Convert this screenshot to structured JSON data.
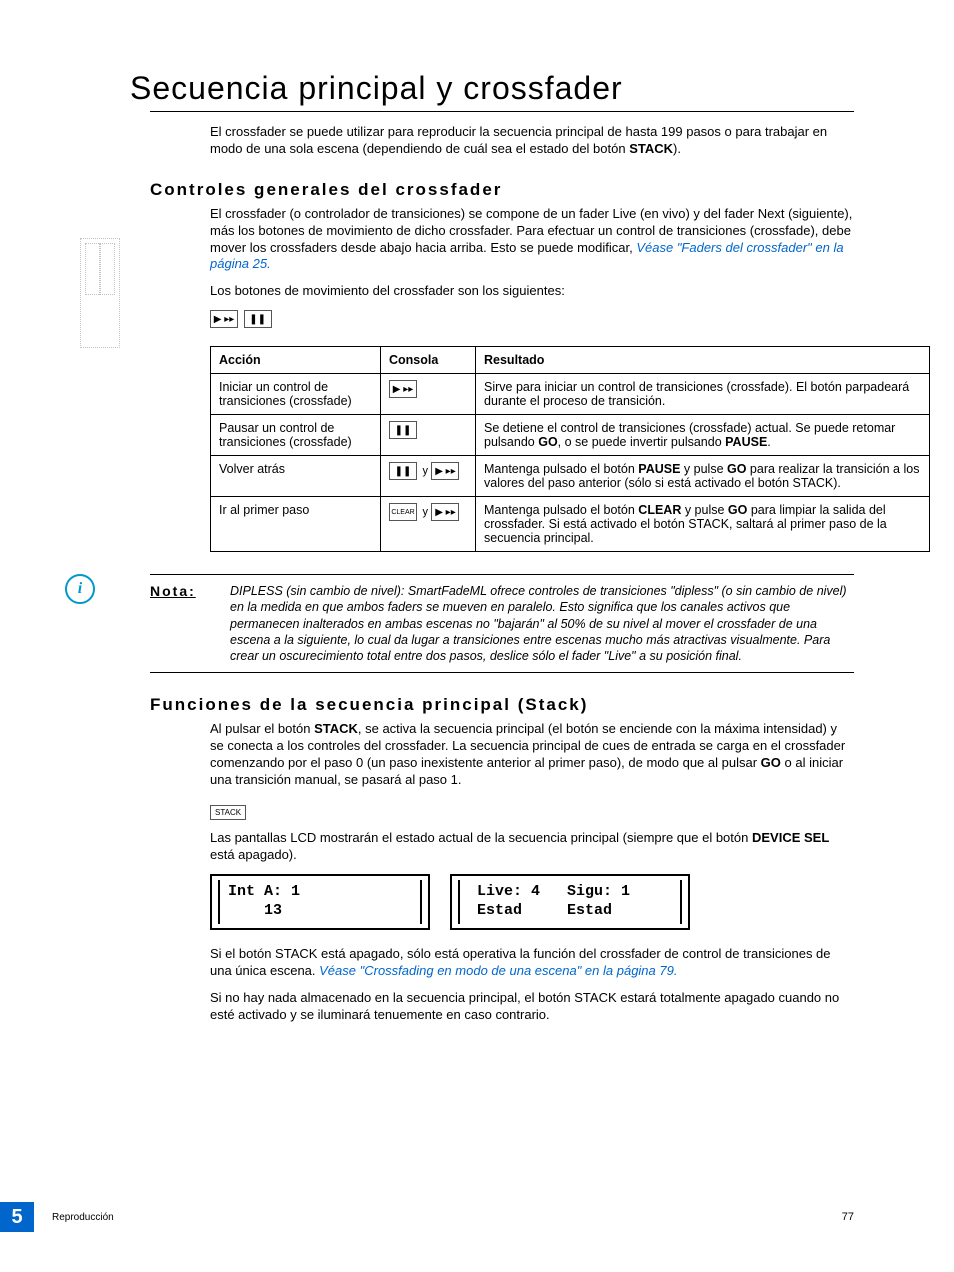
{
  "title": "Secuencia principal y crossfader",
  "intro": {
    "pre": "El crossfader se puede utilizar para reproducir la secuencia principal de hasta 199 pasos o para trabajar en modo de una sola escena (dependiendo de cuál sea el estado del botón ",
    "bold": "STACK",
    "post": ")."
  },
  "section1": {
    "heading": "Controles generales del crossfader",
    "p1_pre": "El crossfader (o controlador de transiciones) se compone de un fader Live (en vivo) y del fader  Next (siguiente), más los botones de movimiento de dicho crossfader. Para efectuar un control de transiciones (crossfade), debe mover los crossfaders desde abajo hacia arriba. Esto se puede modificar, ",
    "p1_link": "Véase \"Faders del crossfader\" en la página  25.",
    "p2": "Los botones de movimiento del crossfader son los siguientes:"
  },
  "table": {
    "h1": "Acción",
    "h2": "Consola",
    "h3": "Resultado",
    "rows": [
      {
        "accion": "Iniciar un control de transiciones (crossfade)",
        "consola_icons": [
          "go"
        ],
        "resultado": "Sirve para iniciar un control de transiciones (crossfade). El botón parpadeará durante el proceso de transición."
      },
      {
        "accion": "Pausar un control de transiciones (crossfade)",
        "consola_icons": [
          "pause"
        ],
        "resultado_pre": "Se detiene el control de transiciones (crossfade) actual. Se puede retomar pulsando ",
        "resultado_b1": "GO",
        "resultado_mid": ", o se puede invertir pulsando ",
        "resultado_b2": "PAUSE",
        "resultado_post": "."
      },
      {
        "accion": "Volver atrás",
        "consola_icons": [
          "pause",
          "y",
          "go"
        ],
        "resultado_pre": "Mantenga pulsado el botón ",
        "resultado_b1": "PAUSE",
        "resultado_mid": " y pulse ",
        "resultado_b2": "GO",
        "resultado_post": " para realizar la transición a los valores del paso anterior (sólo si está activado el botón STACK)."
      },
      {
        "accion": "Ir al primer paso",
        "consola_icons": [
          "clear",
          "y",
          "go"
        ],
        "resultado_pre": "Mantenga pulsado el botón ",
        "resultado_b1": "CLEAR",
        "resultado_mid": " y pulse ",
        "resultado_b2": "GO",
        "resultado_post": " para limpiar la salida del crossfader. Si está activado el botón STACK, saltará al primer paso de la secuencia principal."
      }
    ]
  },
  "note": {
    "label": "Nota:",
    "text": "DIPLESS (sin cambio de nivel): SmartFadeML ofrece controles de transiciones \"dipless\" (o sin cambio de nivel) en la medida en que ambos faders se mueven en paralelo. Esto significa que los canales activos que permanecen inalterados en ambas escenas no \"bajarán\" al 50% de su nivel al mover el crossfader de una escena a la siguiente, lo cual da lugar a transiciones entre escenas mucho más atractivas visualmente. Para crear un oscurecimiento total entre dos pasos, deslice sólo el fader \"Live\" a su posición final."
  },
  "section2": {
    "heading": "Funciones de la secuencia principal (Stack)",
    "p1_a": "Al pulsar el botón ",
    "p1_b1": "STACK",
    "p1_b": ", se activa la secuencia principal (el botón se enciende con la máxima intensidad) y se conecta a los controles del crossfader. La secuencia principal de cues de entrada se carga en el crossfader comenzando por el paso 0 (un paso inexistente anterior al primer paso), de modo que al pulsar ",
    "p1_b2": "GO",
    "p1_c": " o al iniciar una transición manual, se pasará al paso 1.",
    "stack_label": "STACK",
    "p2_a": "Las pantallas LCD mostrarán el estado actual de la secuencia principal (siempre que el botón ",
    "p2_b1": "DEVICE SEL",
    "p2_b": " está apagado).",
    "lcd1_l1": "Int A: 1",
    "lcd1_l2": "    13",
    "lcd2_l1": " Live: 4   Sigu: 1",
    "lcd2_l2": " Estad     Estad",
    "p3_a": "Si el botón STACK está apagado, sólo está operativa la función del crossfader de control de transiciones de una única escena. ",
    "p3_link": "Véase \"Crossfading en modo de una escena\" en la página  79.",
    "p4": "Si no hay nada almacenado en la secuencia principal, el botón STACK estará totalmente apagado cuando no esté activado y se iluminará tenuemente en caso contrario."
  },
  "footer": {
    "chapter": "5",
    "section": "Reproducción",
    "page": "77"
  },
  "icons": {
    "go": "▶ ▸▸",
    "pause": "❚❚",
    "clear": "CLEAR",
    "y": "y"
  }
}
